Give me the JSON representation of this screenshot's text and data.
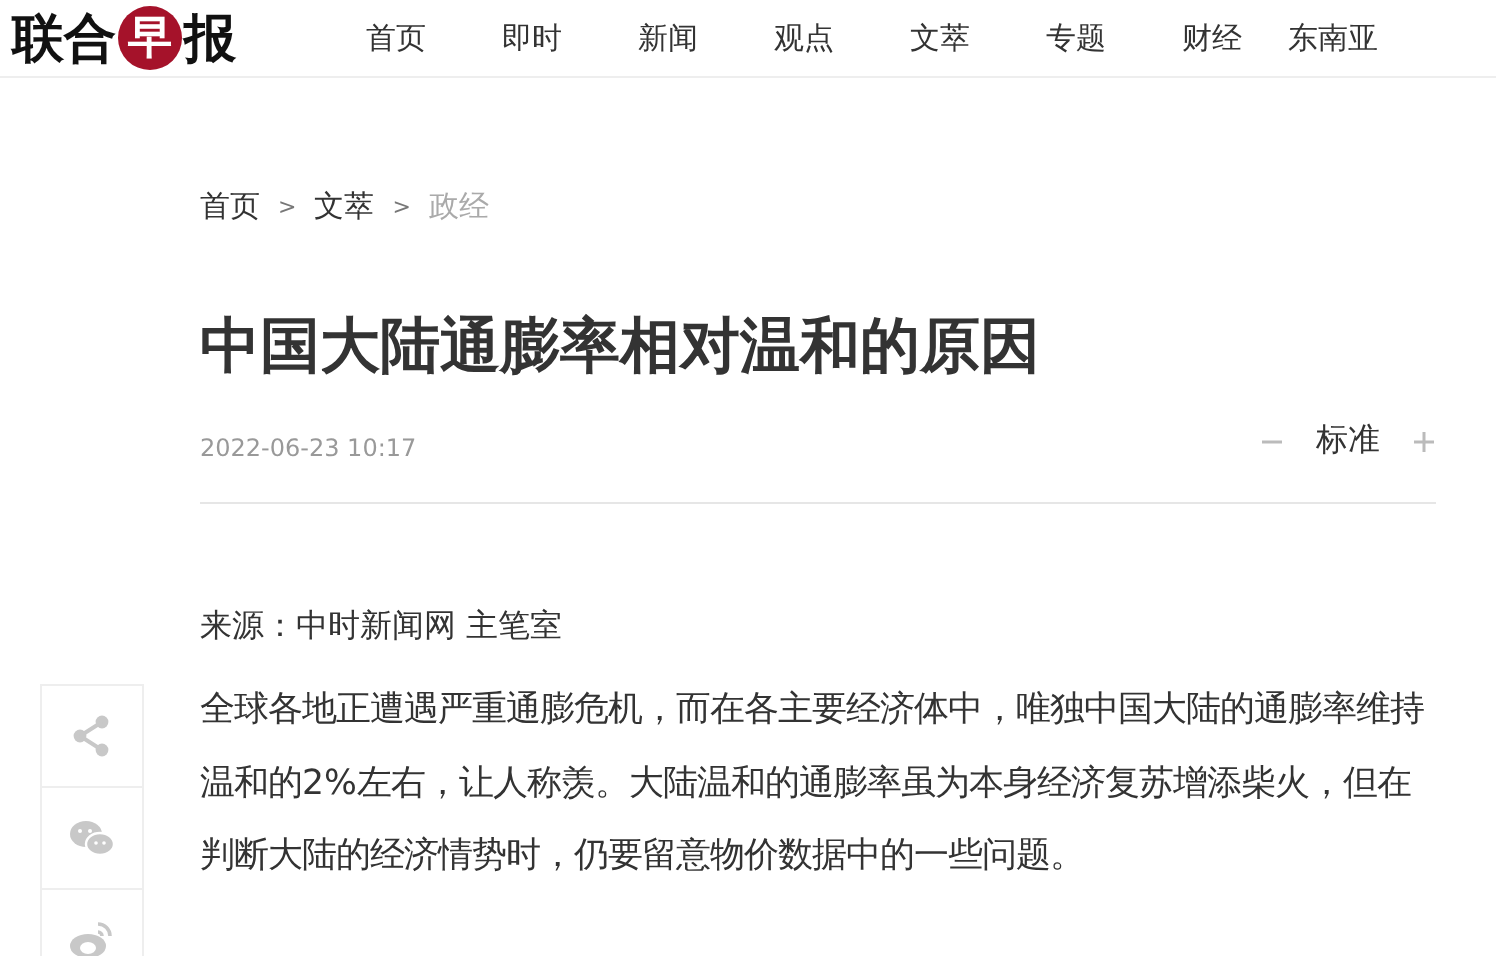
{
  "logo": {
    "parts": [
      {
        "text": "联合",
        "kind": "plain"
      },
      {
        "text": "早",
        "kind": "badge"
      },
      {
        "text": "报",
        "kind": "plain"
      }
    ]
  },
  "nav": [
    "首页",
    "即时",
    "新闻",
    "观点",
    "文萃",
    "专题",
    "财经",
    "东南亚"
  ],
  "breadcrumb": [
    {
      "label": "首页",
      "selected": false
    },
    {
      "label": "文萃",
      "selected": false
    },
    {
      "label": "政经",
      "selected": true
    }
  ],
  "breadcrumb_separator": ">",
  "article": {
    "title": "中国大陆通膨率相对温和的原因",
    "date": "2022-06-23 10:17",
    "font_size": "标准",
    "source": "来源：中时新闻网 主笔室",
    "paragraphs": [
      "全球各地正遭遇严重通膨危机，而在各主要经济体中，唯独中国大陆的通膨率维持温和的2%左右，让人称羡。大陆温和的通膨率虽为本身经济复苏增添柴火，但在判断大陆的经济情势时，仍要留意物价数据中的一些问题。"
    ]
  },
  "share": [
    {
      "kind": "share"
    },
    {
      "kind": "wechat"
    },
    {
      "kind": "weibo"
    }
  ]
}
